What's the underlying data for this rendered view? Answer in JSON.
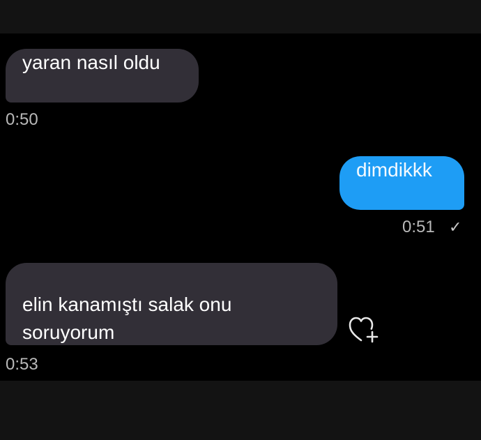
{
  "messages": [
    {
      "direction": "incoming",
      "text": "yaran nasıl oldu",
      "time": "0:50"
    },
    {
      "direction": "outgoing",
      "text": "dimdikkk",
      "time": "0:51",
      "status_icon": "checkmark-icon",
      "status_glyph": "✓"
    },
    {
      "direction": "incoming",
      "text": "elin kanamıştı salak onu\nsoruyorum",
      "time": "0:53",
      "reaction_icon": "heart-plus-icon"
    }
  ],
  "colors": {
    "background": "#000000",
    "bar": "#131313",
    "incoming_bubble": "#322f37",
    "outgoing_bubble": "#1e9df5",
    "timestamp": "#b9b9b9"
  }
}
